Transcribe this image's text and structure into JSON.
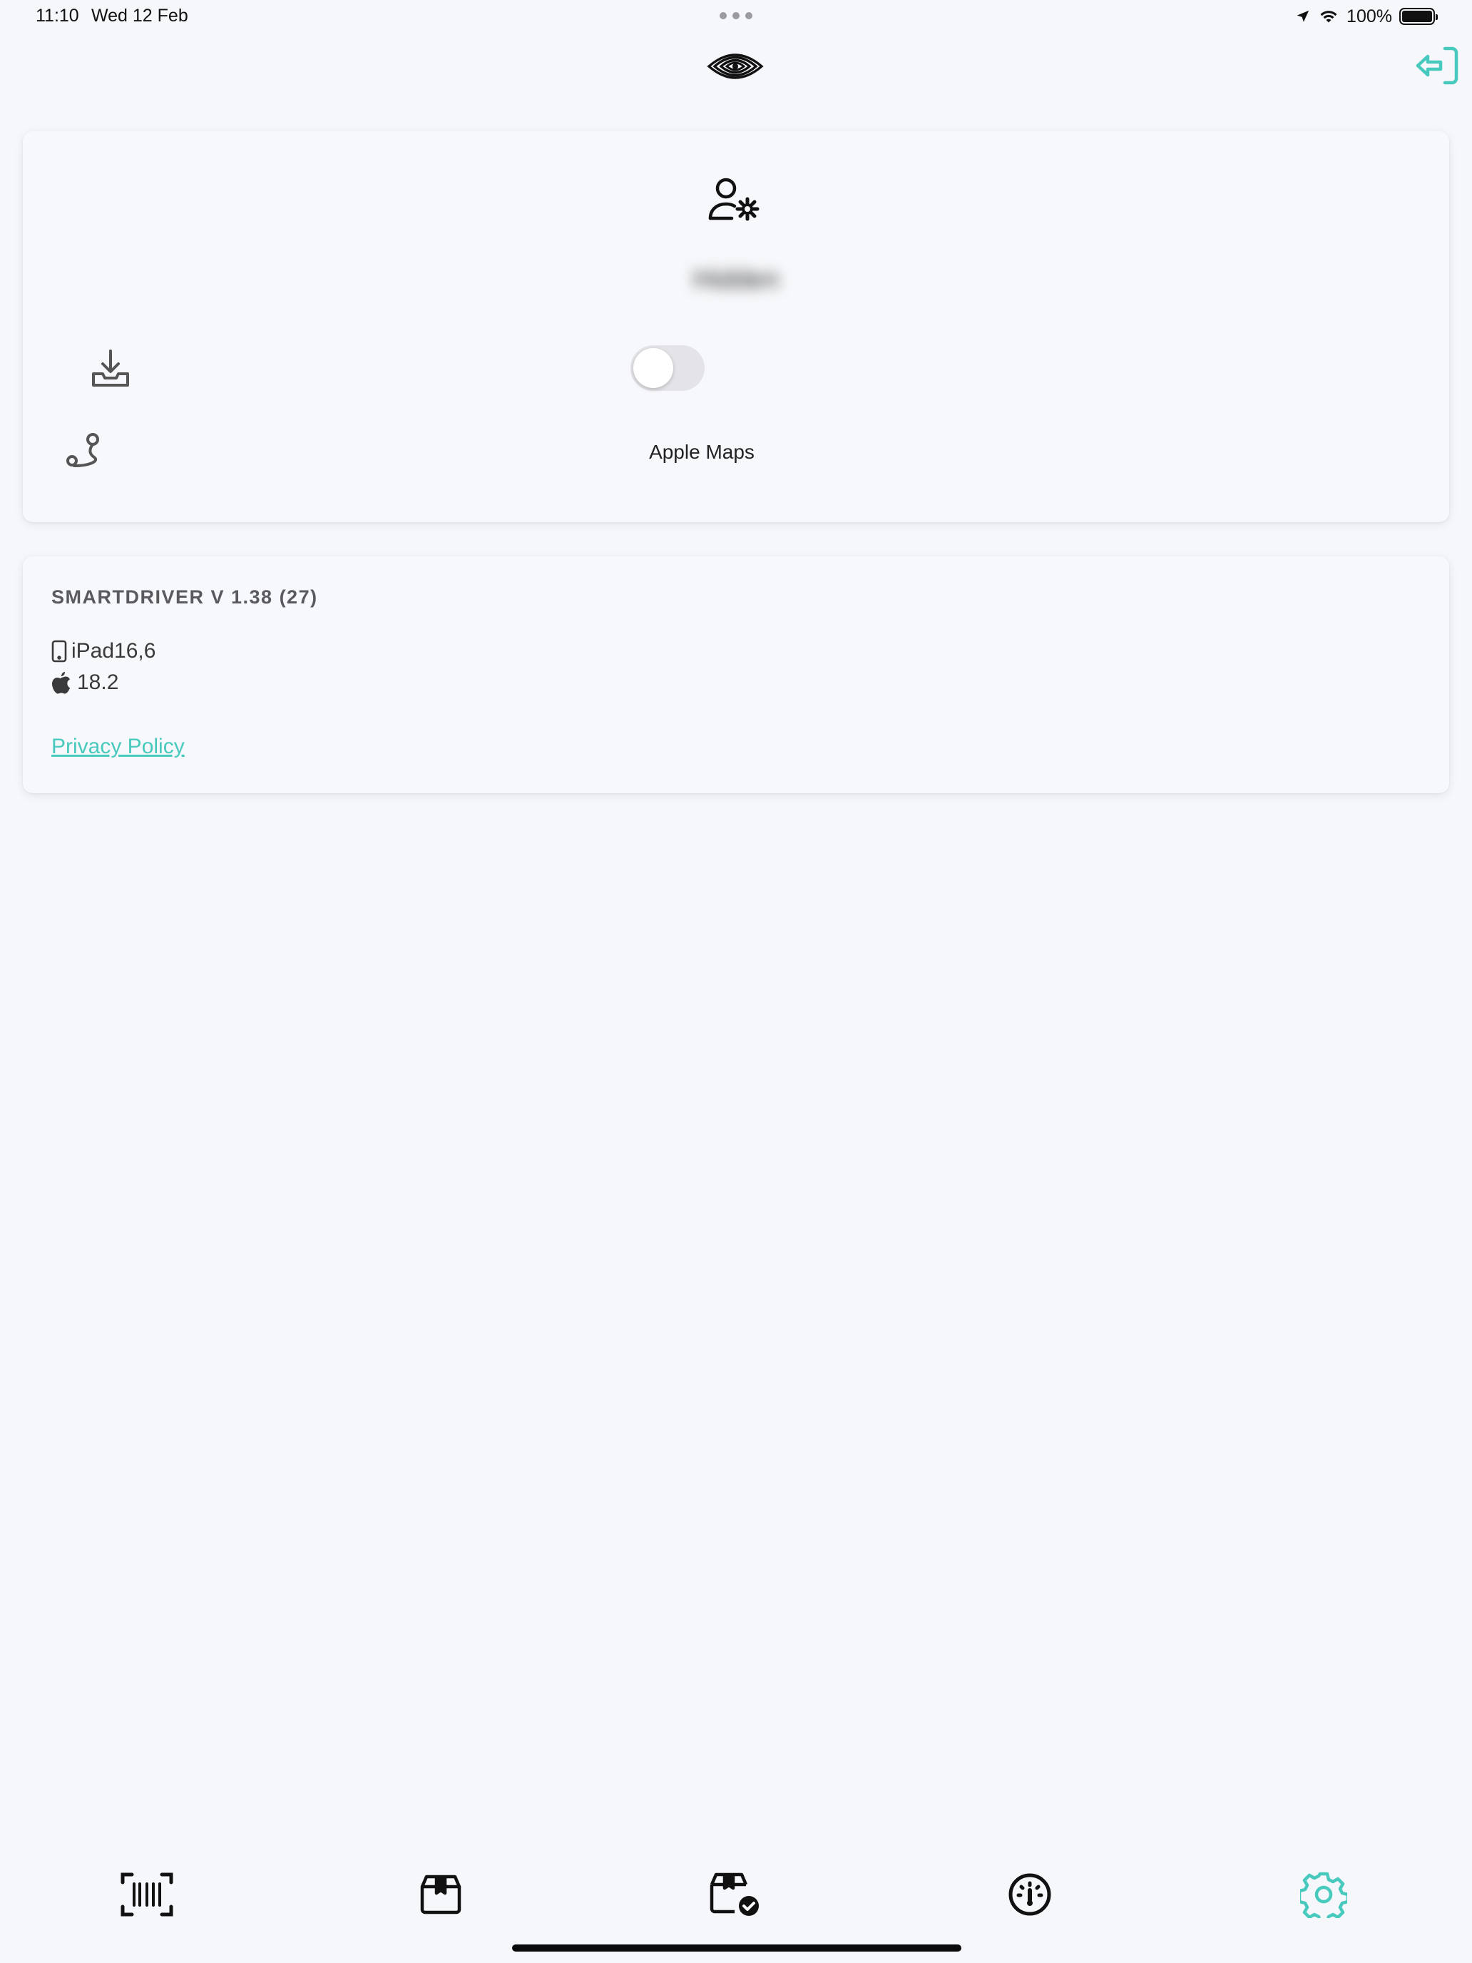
{
  "status_bar": {
    "time": "11:10",
    "date": "Wed 12 Feb",
    "battery": "100%"
  },
  "header": {
    "logo_icon": "eye-logo-icon",
    "logout_icon": "logout-icon"
  },
  "profile_card": {
    "icon": "user-settings-icon",
    "username": "Hidden",
    "offline_download_icon": "download-tray-icon",
    "offline_toggle_on": false,
    "route_icon": "route-icon",
    "navigation_app": "Apple Maps"
  },
  "info_card": {
    "version": "SMARTDRIVER V 1.38 (27)",
    "device": "iPad16,6",
    "os_version": "18.2",
    "privacy_link": "Privacy Policy"
  },
  "tab_bar": {
    "tabs": [
      {
        "icon": "barcode-scan-icon",
        "active": false
      },
      {
        "icon": "package-icon",
        "active": false
      },
      {
        "icon": "package-check-icon",
        "active": false
      },
      {
        "icon": "dashboard-gauge-icon",
        "active": false
      },
      {
        "icon": "settings-gear-icon",
        "active": true
      }
    ]
  },
  "colors": {
    "accent": "#48c9bd",
    "background": "#f6f7fb",
    "icon": "#1c1c1e"
  }
}
